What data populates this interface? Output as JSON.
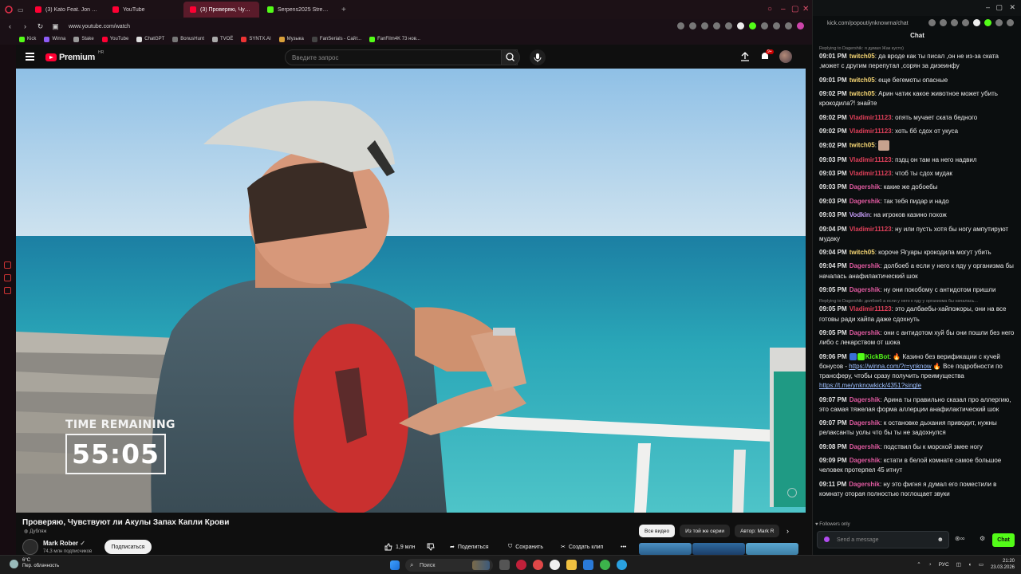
{
  "browser": {
    "tabs": [
      {
        "label": "(3) Kato Feat. Jon - Turn",
        "color": "#ff0033",
        "active": false
      },
      {
        "label": "YouTube",
        "color": "#ff0033",
        "active": false
      },
      {
        "label": "(3) Проверяю, Чувств",
        "color": "#ff0033",
        "active": true
      },
      {
        "label": "Serpens2025 Stream - Wa",
        "color": "#53fc18",
        "active": false
      }
    ],
    "url": "www.youtube.com/watch",
    "bookmarks": [
      "Kick",
      "Winna",
      "Stake",
      "YouTube",
      "ChatGPT",
      "BonusHunt",
      "TVOЁ",
      "SYNTX.AI",
      "Музыка",
      "FanSerials - Сайт...",
      "FanFilm4K 73 нов..."
    ]
  },
  "youtube": {
    "logo_text": "Premium",
    "logo_region": "HR",
    "search_placeholder": "Введите запрос",
    "notification_count": "9+",
    "video": {
      "overlay_label": "TIME REMAINING",
      "overlay_time": "55:05",
      "title": "Проверяю, Чувствуют ли Акулы Запах Капли Крови",
      "dub_label": "Дубляж"
    },
    "channel": {
      "name": "Mark Rober",
      "subscribers": "74,3 млн подписчиков",
      "subscribe_label": "Подписаться"
    },
    "actions": {
      "likes": "1,9 млн",
      "share": "Поделиться",
      "save": "Сохранить",
      "clip": "Создать клип"
    },
    "filters": [
      "Все видео",
      "Из той же серии",
      "Автор: Mark R"
    ]
  },
  "chat": {
    "url": "kick.com/popout/ynknowrna/chat",
    "title": "Chat",
    "messages": [
      {
        "reply": "Replying to Dagershik: я думая Жак кусто)",
        "time": "09:01 PM",
        "user": "twitch05",
        "color": "#f7d774",
        "text": "да вроде как ты писал ,он не из-за ската ,может с другим перепутал ,сорян за дизеинфу"
      },
      {
        "time": "09:01 PM",
        "user": "twitch05",
        "color": "#f7d774",
        "text": "еще бегемоты опасные"
      },
      {
        "time": "09:02 PM",
        "user": "twitch05",
        "color": "#f7d774",
        "text": "Арин чатик какое животное может убить крокодила?! знайте"
      },
      {
        "time": "09:02 PM",
        "user": "Vladimir11123",
        "color": "#e0405a",
        "text": "опять мучает ската бедного"
      },
      {
        "time": "09:02 PM",
        "user": "Vladimir11123",
        "color": "#e0405a",
        "text": "хоть бб сдох от укуса"
      },
      {
        "time": "09:02 PM",
        "user": "twitch05",
        "color": "#f7d774",
        "text": "",
        "emote": true
      },
      {
        "time": "09:03 PM",
        "user": "Vladimir11123",
        "color": "#e0405a",
        "text": "пздц он там на него надвил"
      },
      {
        "time": "09:03 PM",
        "user": "Vladimir11123",
        "color": "#e0405a",
        "text": "чтоб ты сдох мудак"
      },
      {
        "time": "09:03 PM",
        "user": "Dagershik",
        "color": "#e05aa0",
        "text": "какие же добоебы"
      },
      {
        "time": "09:03 PM",
        "user": "Dagershik",
        "color": "#e05aa0",
        "text": "так тебя пидар и надо"
      },
      {
        "time": "09:03 PM",
        "user": "Vodkin",
        "color": "#c59cf6",
        "text": "на игроков казино похож"
      },
      {
        "time": "09:04 PM",
        "user": "Vladimir11123",
        "color": "#e0405a",
        "text": "ну или пусть хотя бы ногу ампутируют мудаку"
      },
      {
        "time": "09:04 PM",
        "user": "twitch05",
        "color": "#f7d774",
        "text": "короче Ягуары крокодила могут убить"
      },
      {
        "time": "09:04 PM",
        "user": "Dagershik",
        "color": "#e05aa0",
        "text": "долбоеб а если у него к яду у организма бы началась анафилактический шок"
      },
      {
        "time": "09:05 PM",
        "user": "Dagershik",
        "color": "#e05aa0",
        "text": "ну они покобому с антидотом пришли"
      },
      {
        "reply": "Replying to Dagershik: долбоеб а если у него к яду у организма бы началась...",
        "time": "09:05 PM",
        "user": "Vladimir11123",
        "color": "#e0405a",
        "text": "это далбаебы-хайпожоры, они на все готовы ради хайпа даже сдохнуть"
      },
      {
        "time": "09:05 PM",
        "user": "Dagershik",
        "color": "#e05aa0",
        "text": "они с антидотом хуй бы они пошли без него либо с лекарством от шока"
      },
      {
        "time": "09:06 PM",
        "user": "KickBot",
        "color": "#53fc18",
        "text": "🔥 Казино без верификации с кучей бонусов -",
        "link1": "https://winna.com/?r=ynknow",
        "text2": "🔥 Все подробности по трансферу, чтобы сразу получить преимущества",
        "link2": "https://t.me/ynknowkick/4351?single",
        "bot": true
      },
      {
        "time": "09:07 PM",
        "user": "Dagershik",
        "color": "#e05aa0",
        "text": "Арина ты правильно сказал про аллергию, это самая тяжелая форма аллерции анафилактический шок"
      },
      {
        "time": "09:07 PM",
        "user": "Dagershik",
        "color": "#e05aa0",
        "text": "к остановке дыхания приводит, нужны релаксанты уолы что бы ты не задохнулся"
      },
      {
        "time": "09:08 PM",
        "user": "Dagershik",
        "color": "#e05aa0",
        "text": "подствил бы к морской змее ногу"
      },
      {
        "time": "09:09 PM",
        "user": "Dagershik",
        "color": "#e05aa0",
        "text": "кстати в белой комнате самое большое человек протерпел 45 итнут"
      },
      {
        "time": "09:11 PM",
        "user": "Dagershik",
        "color": "#e05aa0",
        "text": "ну это фигня я думал его поместили в комнату оторая полностью поглощает звуки"
      }
    ],
    "followers_only": "Followers only",
    "input_placeholder": "Send a message",
    "send_label": "Chat"
  },
  "taskbar": {
    "temp": "6°C",
    "weather": "Пер. облачность",
    "search": "Поиск",
    "lang": "РУС",
    "time": "21:20",
    "date": "23.03.2026"
  }
}
